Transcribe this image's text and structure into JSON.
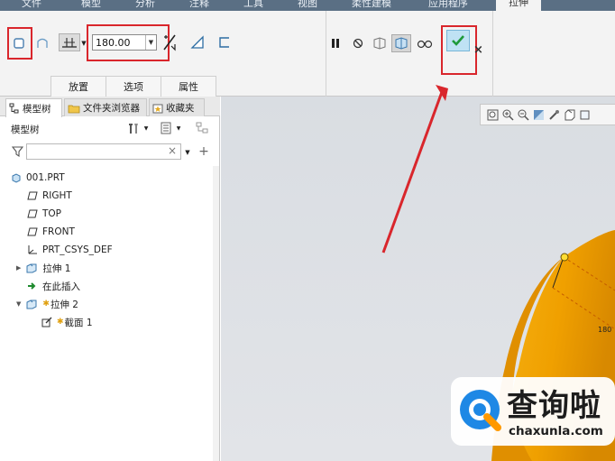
{
  "ribbon_tabs": [
    {
      "label": "文件"
    },
    {
      "label": "模型"
    },
    {
      "label": "分析"
    },
    {
      "label": "注释"
    },
    {
      "label": "工具"
    },
    {
      "label": "视图"
    },
    {
      "label": "柔性建模"
    },
    {
      "label": "应用程序"
    },
    {
      "label": "拉伸"
    }
  ],
  "ribbon": {
    "depth_value": "180.00",
    "groups": [
      "放置",
      "选项",
      "属性"
    ]
  },
  "panel": {
    "tabs": [
      "模型树",
      "文件夹浏览器",
      "收藏夹"
    ],
    "subtitle": "模型树",
    "search_placeholder": ""
  },
  "tree": [
    {
      "label": "001.PRT",
      "icon": "part-icon"
    },
    {
      "label": "RIGHT",
      "icon": "datum-plane-icon"
    },
    {
      "label": "TOP",
      "icon": "datum-plane-icon"
    },
    {
      "label": "FRONT",
      "icon": "datum-plane-icon"
    },
    {
      "label": "PRT_CSYS_DEF",
      "icon": "csys-icon"
    },
    {
      "label": "拉伸 1",
      "icon": "extrude-icon"
    },
    {
      "label": "在此插入",
      "icon": "insert-arrow-icon"
    },
    {
      "label": "拉伸 2",
      "icon": "extrude-icon"
    },
    {
      "label": "截面 1",
      "icon": "sketch-icon"
    }
  ],
  "viewport": {
    "dimension_label": "180",
    "model_color": "#f0a000"
  },
  "watermark": {
    "title": "查询啦",
    "subtitle": "chaxunla.com"
  },
  "colors": {
    "highlight_red": "#d9262c",
    "ok_blue": "#bfe2f4"
  }
}
